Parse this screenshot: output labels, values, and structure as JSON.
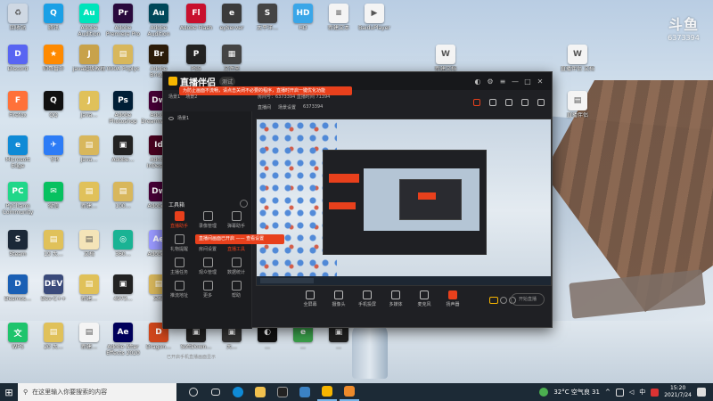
{
  "desktop": {
    "icons": [
      {
        "label": "回收站",
        "color": "#cfd8e3",
        "glyph": "♻",
        "pos": "c0r0"
      },
      {
        "label": "腾讯",
        "color": "#1aa0e6",
        "glyph": "Q",
        "pos": "c1r0"
      },
      {
        "label": "Adobe Audition 2020",
        "color": "#00e4bb",
        "glyph": "Au",
        "pos": "c2r0"
      },
      {
        "label": "Adobe Premiere Pro 2020",
        "color": "#2a0a3d",
        "glyph": "Pr",
        "pos": "c3r0"
      },
      {
        "label": "Adobe Audition 2020",
        "color": "#00485a",
        "glyph": "Au",
        "pos": "c4r0"
      },
      {
        "label": "Adobe Flash",
        "color": "#c8102e",
        "glyph": "Fl",
        "pos": "c5r0"
      },
      {
        "label": "eyServer",
        "color": "#3b3b3b",
        "glyph": "e",
        "pos": "c6r0"
      },
      {
        "label": "太平洋…",
        "color": "#444",
        "glyph": "S",
        "pos": "c7r0"
      },
      {
        "label": "HD",
        "color": "#3aa6e8",
        "glyph": "HD",
        "pos": "c8r0"
      },
      {
        "label": "新建文本",
        "color": "#f4f4f4",
        "glyph": "≡",
        "pos": "c9r0"
      },
      {
        "label": "BaiduPlayer",
        "color": "#f4f4f4",
        "glyph": "▶",
        "pos": "c10r0"
      },
      {
        "label": "Discord",
        "color": "#5865f2",
        "glyph": "D",
        "pos": "c0r1"
      },
      {
        "label": "帅哥番外",
        "color": "#ff8a00",
        "glyph": "★",
        "pos": "c1r1"
      },
      {
        "label": "java超级教程",
        "color": "#c8a24a",
        "glyph": "J",
        "pos": "c2r1"
      },
      {
        "label": "000A Poplyc",
        "color": "#d8b75c",
        "glyph": "▤",
        "pos": "c3r1"
      },
      {
        "label": "Adobe Bridge",
        "color": "#2b1b09",
        "glyph": "Br",
        "pos": "c4r1"
      },
      {
        "label": "PS5",
        "color": "#222",
        "glyph": "P",
        "pos": "c5r1"
      },
      {
        "label": "文件夹",
        "color": "#444",
        "glyph": "▦",
        "pos": "c6r1"
      },
      {
        "label": "Firefox",
        "color": "#ff7139",
        "glyph": "F",
        "pos": "c0r2"
      },
      {
        "label": "QQ",
        "color": "#111",
        "glyph": "Q",
        "pos": "c1r2"
      },
      {
        "label": "Java…",
        "color": "#e0c15a",
        "glyph": "J",
        "pos": "c2r2"
      },
      {
        "label": "Adobe Photoshop",
        "color": "#001e36",
        "glyph": "Ps",
        "pos": "c3r2"
      },
      {
        "label": "Adobe Dreamweaver",
        "color": "#470137",
        "glyph": "Dw",
        "pos": "c4r2"
      },
      {
        "label": "Microsoft Edge",
        "color": "#0f8ad6",
        "glyph": "e",
        "pos": "c0r3"
      },
      {
        "label": "飞书",
        "color": "#2d7cf6",
        "glyph": "✈",
        "pos": "c1r3"
      },
      {
        "label": "Java…",
        "color": "#d8b75c",
        "glyph": "▤",
        "pos": "c2r3"
      },
      {
        "label": "Adobe…",
        "color": "#222",
        "glyph": "▣",
        "pos": "c3r3"
      },
      {
        "label": "Adobe InDesign",
        "color": "#49021f",
        "glyph": "Id",
        "pos": "c4r3"
      },
      {
        "label": "PyCharm Community",
        "color": "#21d789",
        "glyph": "PC",
        "pos": "c0r4"
      },
      {
        "label": "微信",
        "color": "#07c160",
        "glyph": "✉",
        "pos": "c1r4"
      },
      {
        "label": "新建…",
        "color": "#e0c15a",
        "glyph": "▤",
        "pos": "c2r4"
      },
      {
        "label": "100…",
        "color": "#d8b75c",
        "glyph": "▤",
        "pos": "c3r4"
      },
      {
        "label": "Adobe…",
        "color": "#470137",
        "glyph": "Dw",
        "pos": "c4r4"
      },
      {
        "label": "Steam",
        "color": "#1b2838",
        "glyph": "S",
        "pos": "c0r5"
      },
      {
        "label": "19 大…",
        "color": "#e0c15a",
        "glyph": "▤",
        "pos": "c1r5"
      },
      {
        "label": "文档",
        "color": "#f4e4b8",
        "glyph": "▤",
        "pos": "c2r5"
      },
      {
        "label": "360…",
        "color": "#1ab394",
        "glyph": "◎",
        "pos": "c3r5"
      },
      {
        "label": "Adobe…",
        "color": "#9999ff",
        "glyph": "Ae",
        "pos": "c4r5"
      },
      {
        "label": "Desmos…",
        "color": "#1a5fb4",
        "glyph": "D",
        "pos": "c0r6"
      },
      {
        "label": "Dev-C++",
        "color": "#3a4a7a",
        "glyph": "DEV",
        "pos": "c1r6"
      },
      {
        "label": "新建…",
        "color": "#e0c15a",
        "glyph": "▤",
        "pos": "c2r6"
      },
      {
        "label": "4973…",
        "color": "#222",
        "glyph": "▣",
        "pos": "c3r6"
      },
      {
        "label": "文档",
        "color": "#d8b75c",
        "glyph": "▤",
        "pos": "c4r6"
      },
      {
        "label": "WPS",
        "color": "#1ec46c",
        "glyph": "文",
        "pos": "c0r7"
      },
      {
        "label": "20 大…",
        "color": "#e0c15a",
        "glyph": "▤",
        "pos": "c1r7"
      },
      {
        "label": "新建…",
        "color": "#f4f4f4",
        "glyph": "▤",
        "pos": "c2r7"
      },
      {
        "label": "Adobe After Effects 2020",
        "color": "#00005b",
        "glyph": "Ae",
        "pos": "c3r7"
      },
      {
        "label": "Dragon…",
        "color": "#d0471c",
        "glyph": "D",
        "pos": "c4r7"
      },
      {
        "label": "SoftDown…",
        "color": "#222",
        "glyph": "▣",
        "pos": "c5r7"
      },
      {
        "label": "大…",
        "color": "#333",
        "glyph": "▣",
        "pos": "c6r7"
      },
      {
        "label": "…",
        "color": "#111",
        "glyph": "◐",
        "pos": "c7r7"
      },
      {
        "label": "…",
        "color": "#3aa04a",
        "glyph": "e",
        "pos": "c8r7"
      },
      {
        "label": "…",
        "color": "#222",
        "glyph": "▣",
        "pos": "c9r7"
      },
      {
        "label": "直播伴侣",
        "color": "#f4f4f4",
        "glyph": "▤",
        "pos": "c15r2"
      },
      {
        "label": "直播伴侣 文档",
        "color": "#f4f4f4",
        "glyph": "W",
        "pos": "c15r1"
      },
      {
        "label": "新建文档",
        "color": "#f4f4f4",
        "glyph": "W",
        "pos": "c12r1"
      }
    ]
  },
  "watermark": {
    "logo": "斗鱼",
    "room": "6373394"
  },
  "app": {
    "title": "直播伴侣",
    "version": "测试",
    "notice": "为防止画面不流畅，请点击关闭不必要的程序，直播时开启一键优化功能",
    "tabs": [
      "场景1",
      "场景2"
    ],
    "info": "房间号：6373394   直播时间 71394",
    "info2": [
      "直播间",
      "场景设置",
      "6373394"
    ],
    "scene_name": "场景1",
    "toolbox_title": "工具箱",
    "toolbox": [
      {
        "label": "直播助手",
        "red": true
      },
      {
        "label": "录像管理",
        "red": false
      },
      {
        "label": "弹幕助手",
        "red": false
      },
      {
        "label": "礼物提醒",
        "red": false
      },
      {
        "label": "房间设置",
        "red": false
      },
      {
        "label": "直播工具",
        "red": true
      },
      {
        "label": "主播任务",
        "red": false
      },
      {
        "label": "观众管理",
        "red": false
      },
      {
        "label": "数据统计",
        "red": false
      },
      {
        "label": "推流地址",
        "red": false
      },
      {
        "label": "更多",
        "red": false
      },
      {
        "label": "帮助",
        "red": false
      }
    ],
    "popup": "直播间画面已开启 —— 查看设置",
    "footnote": "已开启手机直播画面显示",
    "controls": [
      "全屏幕",
      "摄像头",
      "手机投屏",
      "多媒体",
      "麦克风",
      "扬声器"
    ],
    "record_label": "开始直播"
  },
  "taskbar": {
    "search_placeholder": "在这里输入你要搜索的内容",
    "weather": "32°C 空气良 31",
    "time": "15:20",
    "date": "2021/7/24",
    "lang": "中"
  }
}
